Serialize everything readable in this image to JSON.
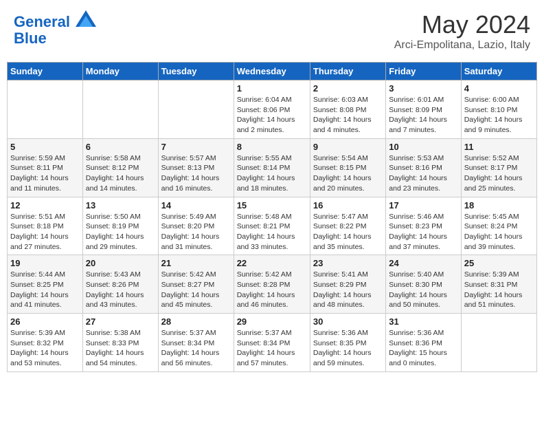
{
  "header": {
    "logo_line1": "General",
    "logo_line2": "Blue",
    "month_title": "May 2024",
    "location": "Arci-Empolitana, Lazio, Italy"
  },
  "days_of_week": [
    "Sunday",
    "Monday",
    "Tuesday",
    "Wednesday",
    "Thursday",
    "Friday",
    "Saturday"
  ],
  "weeks": [
    [
      {
        "day": "",
        "info": ""
      },
      {
        "day": "",
        "info": ""
      },
      {
        "day": "",
        "info": ""
      },
      {
        "day": "1",
        "info": "Sunrise: 6:04 AM\nSunset: 8:06 PM\nDaylight: 14 hours\nand 2 minutes."
      },
      {
        "day": "2",
        "info": "Sunrise: 6:03 AM\nSunset: 8:08 PM\nDaylight: 14 hours\nand 4 minutes."
      },
      {
        "day": "3",
        "info": "Sunrise: 6:01 AM\nSunset: 8:09 PM\nDaylight: 14 hours\nand 7 minutes."
      },
      {
        "day": "4",
        "info": "Sunrise: 6:00 AM\nSunset: 8:10 PM\nDaylight: 14 hours\nand 9 minutes."
      }
    ],
    [
      {
        "day": "5",
        "info": "Sunrise: 5:59 AM\nSunset: 8:11 PM\nDaylight: 14 hours\nand 11 minutes."
      },
      {
        "day": "6",
        "info": "Sunrise: 5:58 AM\nSunset: 8:12 PM\nDaylight: 14 hours\nand 14 minutes."
      },
      {
        "day": "7",
        "info": "Sunrise: 5:57 AM\nSunset: 8:13 PM\nDaylight: 14 hours\nand 16 minutes."
      },
      {
        "day": "8",
        "info": "Sunrise: 5:55 AM\nSunset: 8:14 PM\nDaylight: 14 hours\nand 18 minutes."
      },
      {
        "day": "9",
        "info": "Sunrise: 5:54 AM\nSunset: 8:15 PM\nDaylight: 14 hours\nand 20 minutes."
      },
      {
        "day": "10",
        "info": "Sunrise: 5:53 AM\nSunset: 8:16 PM\nDaylight: 14 hours\nand 23 minutes."
      },
      {
        "day": "11",
        "info": "Sunrise: 5:52 AM\nSunset: 8:17 PM\nDaylight: 14 hours\nand 25 minutes."
      }
    ],
    [
      {
        "day": "12",
        "info": "Sunrise: 5:51 AM\nSunset: 8:18 PM\nDaylight: 14 hours\nand 27 minutes."
      },
      {
        "day": "13",
        "info": "Sunrise: 5:50 AM\nSunset: 8:19 PM\nDaylight: 14 hours\nand 29 minutes."
      },
      {
        "day": "14",
        "info": "Sunrise: 5:49 AM\nSunset: 8:20 PM\nDaylight: 14 hours\nand 31 minutes."
      },
      {
        "day": "15",
        "info": "Sunrise: 5:48 AM\nSunset: 8:21 PM\nDaylight: 14 hours\nand 33 minutes."
      },
      {
        "day": "16",
        "info": "Sunrise: 5:47 AM\nSunset: 8:22 PM\nDaylight: 14 hours\nand 35 minutes."
      },
      {
        "day": "17",
        "info": "Sunrise: 5:46 AM\nSunset: 8:23 PM\nDaylight: 14 hours\nand 37 minutes."
      },
      {
        "day": "18",
        "info": "Sunrise: 5:45 AM\nSunset: 8:24 PM\nDaylight: 14 hours\nand 39 minutes."
      }
    ],
    [
      {
        "day": "19",
        "info": "Sunrise: 5:44 AM\nSunset: 8:25 PM\nDaylight: 14 hours\nand 41 minutes."
      },
      {
        "day": "20",
        "info": "Sunrise: 5:43 AM\nSunset: 8:26 PM\nDaylight: 14 hours\nand 43 minutes."
      },
      {
        "day": "21",
        "info": "Sunrise: 5:42 AM\nSunset: 8:27 PM\nDaylight: 14 hours\nand 45 minutes."
      },
      {
        "day": "22",
        "info": "Sunrise: 5:42 AM\nSunset: 8:28 PM\nDaylight: 14 hours\nand 46 minutes."
      },
      {
        "day": "23",
        "info": "Sunrise: 5:41 AM\nSunset: 8:29 PM\nDaylight: 14 hours\nand 48 minutes."
      },
      {
        "day": "24",
        "info": "Sunrise: 5:40 AM\nSunset: 8:30 PM\nDaylight: 14 hours\nand 50 minutes."
      },
      {
        "day": "25",
        "info": "Sunrise: 5:39 AM\nSunset: 8:31 PM\nDaylight: 14 hours\nand 51 minutes."
      }
    ],
    [
      {
        "day": "26",
        "info": "Sunrise: 5:39 AM\nSunset: 8:32 PM\nDaylight: 14 hours\nand 53 minutes."
      },
      {
        "day": "27",
        "info": "Sunrise: 5:38 AM\nSunset: 8:33 PM\nDaylight: 14 hours\nand 54 minutes."
      },
      {
        "day": "28",
        "info": "Sunrise: 5:37 AM\nSunset: 8:34 PM\nDaylight: 14 hours\nand 56 minutes."
      },
      {
        "day": "29",
        "info": "Sunrise: 5:37 AM\nSunset: 8:34 PM\nDaylight: 14 hours\nand 57 minutes."
      },
      {
        "day": "30",
        "info": "Sunrise: 5:36 AM\nSunset: 8:35 PM\nDaylight: 14 hours\nand 59 minutes."
      },
      {
        "day": "31",
        "info": "Sunrise: 5:36 AM\nSunset: 8:36 PM\nDaylight: 15 hours\nand 0 minutes."
      },
      {
        "day": "",
        "info": ""
      }
    ]
  ]
}
